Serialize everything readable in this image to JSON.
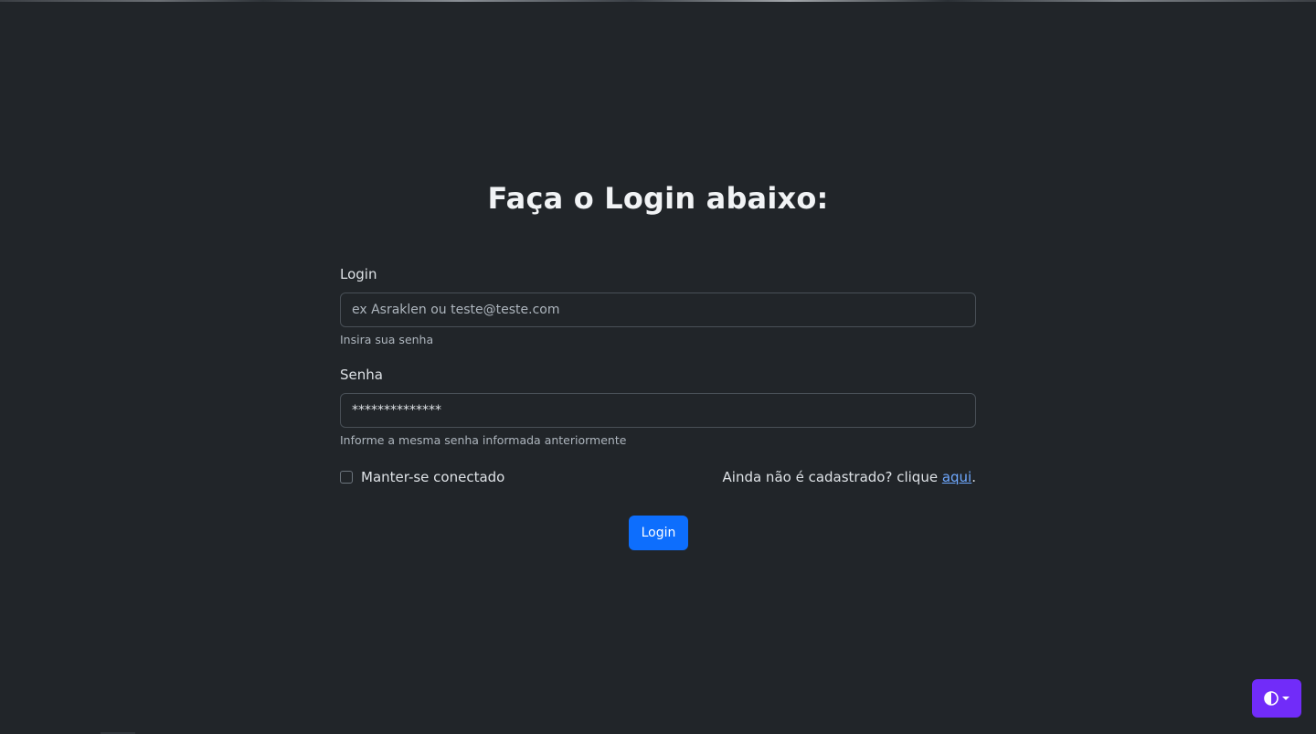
{
  "page": {
    "title": "Faça o Login abaixo:"
  },
  "form": {
    "login_label": "Login",
    "login_placeholder": "ex Asraklen ou teste@teste.com",
    "login_help": "Insira sua senha",
    "password_label": "Senha",
    "password_value": "**************",
    "password_help": "Informe a mesma senha informada anteriormente",
    "remember_label": "Manter-se conectado",
    "register_text": "Ainda não é cadastrado? clique ",
    "register_link": "aqui",
    "register_end": ".",
    "submit_label": "Login"
  },
  "theme_toggle": {
    "icon": "circle-half-icon",
    "color": "#712cf9"
  },
  "colors": {
    "background": "#212529",
    "primary": "#0d6efd",
    "link": "#6ea8fe"
  }
}
